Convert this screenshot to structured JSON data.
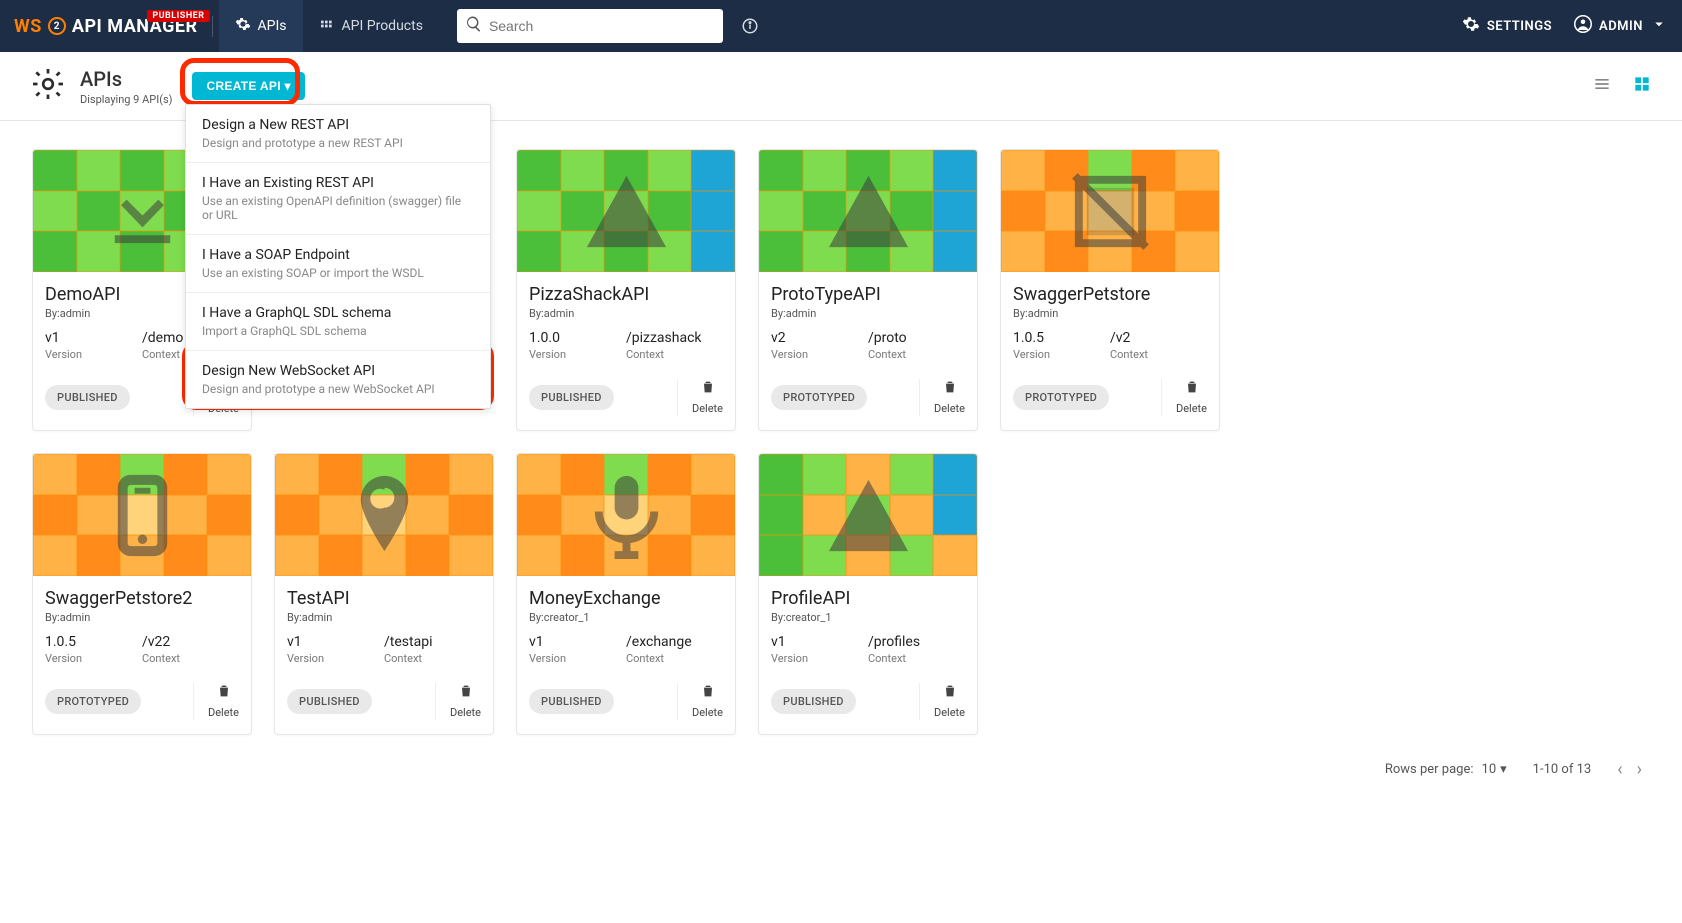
{
  "brand": {
    "publisher_badge": "PUBLISHER",
    "name_rest": "API MANAGER"
  },
  "nav": {
    "apis": "APIs",
    "api_products": "API Products",
    "search_placeholder": "Search",
    "settings": "SETTINGS",
    "admin": "ADMIN"
  },
  "subheader": {
    "title": "APIs",
    "subtitle": "Displaying 9 API(s)",
    "create_btn": "CREATE API ▾"
  },
  "dropdown": [
    {
      "title": "Design a New REST API",
      "sub": "Design and prototype a new REST API"
    },
    {
      "title": "I Have an Existing REST API",
      "sub": "Use an existing OpenAPI definition (swagger) file or URL"
    },
    {
      "title": "I Have a SOAP Endpoint",
      "sub": "Use an existing SOAP or import the WSDL"
    },
    {
      "title": "I Have a GraphQL SDL schema",
      "sub": "Import a GraphQL SDL schema"
    },
    {
      "title": "Design New WebSocket API",
      "sub": "Design and prototype a new WebSocket API"
    }
  ],
  "labels": {
    "version": "Version",
    "context": "Context",
    "delete": "Delete"
  },
  "cards": [
    {
      "title": "DemoAPI",
      "by": "By:admin",
      "version": "v1",
      "context": "/demo",
      "status": "PUBLISHED",
      "thumb": "green",
      "icon": "download"
    },
    {
      "title": "",
      "by": "",
      "version": "",
      "context": "",
      "status": "",
      "thumb": "orange",
      "icon": "warn",
      "hidden": true
    },
    {
      "title": "PizzaShackAPI",
      "by": "By:admin",
      "version": "1.0.0",
      "context": "/pizzashack",
      "status": "PUBLISHED",
      "thumb": "green",
      "icon": "warn"
    },
    {
      "title": "ProtoTypeAPI",
      "by": "By:admin",
      "version": "v2",
      "context": "/proto",
      "status": "PROTOTYPED",
      "thumb": "green",
      "icon": "warn"
    },
    {
      "title": "SwaggerPetstore",
      "by": "By:admin",
      "version": "1.0.5",
      "context": "/v2",
      "status": "PROTOTYPED",
      "thumb": "orange",
      "icon": "noimage"
    },
    {
      "title": "SwaggerPetstore2",
      "by": "By:admin",
      "version": "1.0.5",
      "context": "/v22",
      "status": "PROTOTYPED",
      "thumb": "orange",
      "icon": "device"
    },
    {
      "title": "TestAPI",
      "by": "By:admin",
      "version": "v1",
      "context": "/testapi",
      "status": "PUBLISHED",
      "thumb": "orange",
      "icon": "pin"
    },
    {
      "title": "MoneyExchange",
      "by": "By:creator_1",
      "version": "v1",
      "context": "/exchange",
      "status": "PUBLISHED",
      "thumb": "orange",
      "icon": "mic"
    },
    {
      "title": "ProfileAPI",
      "by": "By:creator_1",
      "version": "v1",
      "context": "/profiles",
      "status": "PUBLISHED",
      "thumb": "green2",
      "icon": "warn"
    }
  ],
  "pagination": {
    "rows_label": "Rows per page:",
    "rows_value": "10",
    "range": "1-10 of 13"
  }
}
